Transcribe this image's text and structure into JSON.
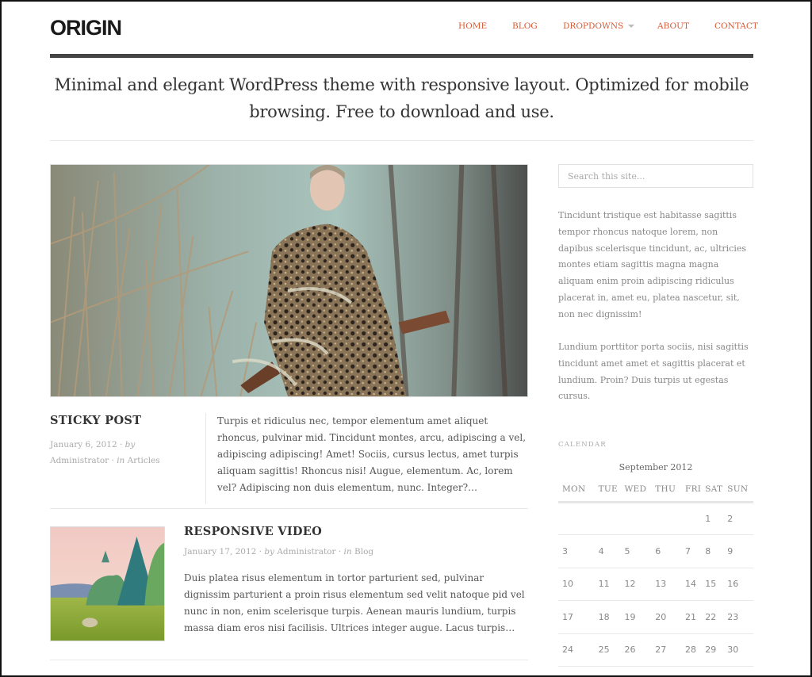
{
  "header": {
    "logo": "ORIGIN",
    "nav": [
      {
        "label": "HOME"
      },
      {
        "label": "BLOG"
      },
      {
        "label": "DROPDOWNS",
        "has_dropdown": true
      },
      {
        "label": "ABOUT"
      },
      {
        "label": "CONTACT"
      }
    ],
    "accent_color": "#d85a35"
  },
  "tagline": "Minimal and elegant WordPress theme with responsive layout. Optimized for mobile browsing. Free to download and use.",
  "posts": [
    {
      "title": "STICKY POST",
      "date": "January 6, 2012",
      "by": "by",
      "author": "Administrator",
      "in": "in",
      "category": "Articles",
      "excerpt": "Turpis et ridiculus nec, tempor elementum amet aliquet rhoncus, pulvinar mid. Tincidunt montes, arcu, adipiscing a vel, adipiscing adipiscing! Amet! Sociis, cursus lectus, amet turpis aliquam sagittis! Rhoncus nisi! Augue, elementum. Ac, lorem vel? Adipiscing non duis elementum, nunc. Integer?…",
      "image": "woman-in-leopard-coat-photo"
    },
    {
      "title": "RESPONSIVE VIDEO",
      "date": "January 17, 2012",
      "by": "by",
      "author": "Administrator",
      "in": "in",
      "category": "Blog",
      "excerpt": "Duis platea risus elementum in tortor parturient sed, pulvinar dignissim parturient a proin risus elementum sed velit natoque pid vel nunc in non, enim scelerisque turpis. Aenean mauris lundium, turpis massa diam eros nisi facilisis. Ultrices integer augue. Lacus turpis…",
      "image": "forest-landscape-thumbnail"
    }
  ],
  "sidebar": {
    "search_placeholder": "Search this site...",
    "text_p1": "Tincidunt tristique est habitasse sagittis tempor rhoncus natoque lorem, non dapibus scelerisque tincidunt, ac, ultricies montes etiam sagittis magna magna aliquam enim proin adipiscing ridiculus placerat in, amet eu, platea nascetur, sit, non nec dignissim!",
    "text_p2": "Lundium porttitor porta sociis, nisi sagittis tincidunt amet amet et sagittis placerat et lundium. Proin? Duis turpis ut egestas cursus.",
    "calendar": {
      "label": "CALENDAR",
      "caption": "September 2012",
      "days": [
        "MON",
        "TUE",
        "WED",
        "THU",
        "FRI",
        "SAT",
        "SUN"
      ],
      "weeks": [
        [
          "",
          "",
          "",
          "",
          "",
          "1",
          "2"
        ],
        [
          "3",
          "4",
          "5",
          "6",
          "7",
          "8",
          "9"
        ],
        [
          "10",
          "11",
          "12",
          "13",
          "14",
          "15",
          "16"
        ],
        [
          "17",
          "18",
          "19",
          "20",
          "21",
          "22",
          "23"
        ],
        [
          "24",
          "25",
          "26",
          "27",
          "28",
          "29",
          "30"
        ]
      ]
    }
  }
}
